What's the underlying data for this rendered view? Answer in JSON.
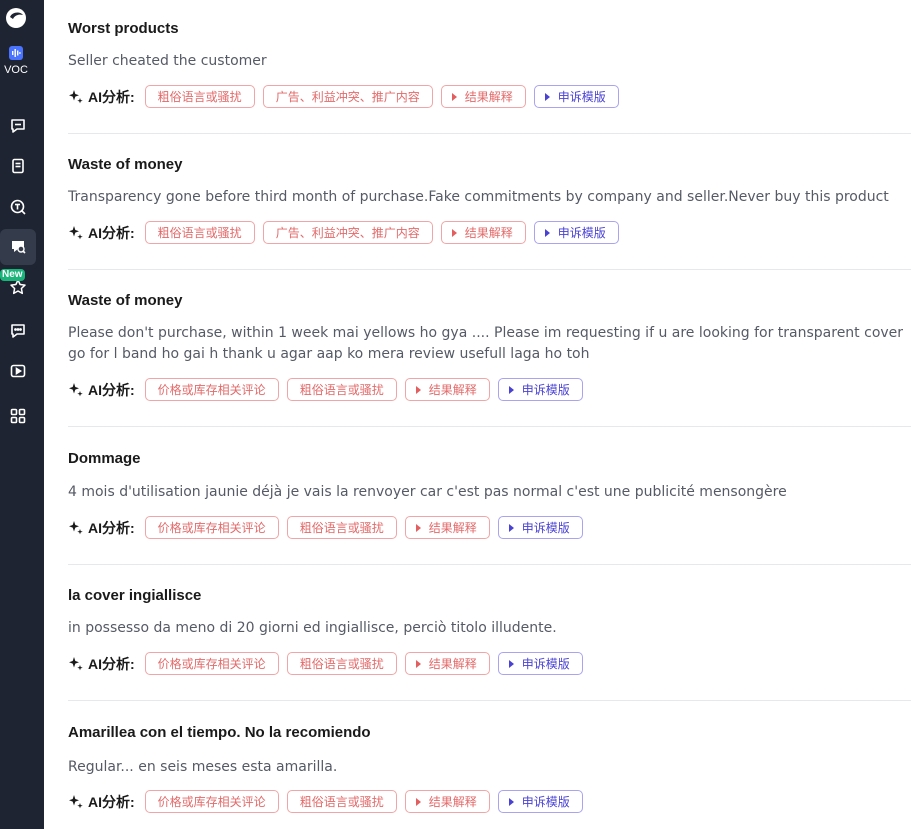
{
  "sidebar": {
    "voc_label": "VOC",
    "new_badge": "New",
    "items": [
      {
        "icon": "chat-bubble-icon"
      },
      {
        "icon": "document-icon"
      },
      {
        "icon": "search-t-icon"
      },
      {
        "icon": "review-search-icon",
        "active": true
      },
      {
        "icon": "star-icon"
      },
      {
        "icon": "message-dots-icon"
      },
      {
        "icon": "play-icon"
      },
      {
        "icon": "grid-apps-icon"
      }
    ]
  },
  "ai_label": "AI分析:",
  "reviews": [
    {
      "title": "Worst products",
      "body": "Seller cheated the customer",
      "tags": [
        "粗俗语言或骚扰",
        "广告、利益冲突、推广内容"
      ],
      "explain": "结果解释",
      "template": "申诉模版"
    },
    {
      "title": "Waste of money",
      "body": "Transparency gone before third month of purchase.Fake commitments by company and seller.Never buy this product",
      "tags": [
        "粗俗语言或骚扰",
        "广告、利益冲突、推广内容"
      ],
      "explain": "结果解释",
      "template": "申诉模版"
    },
    {
      "title": "Waste of money",
      "body": "Please don't purchase, within 1 week mai yellows ho gya .... Please im requesting if u are looking for transparent cover go for l band ho gai h thank u agar aap ko mera review usefull laga ho toh",
      "tags": [
        "价格或库存相关评论",
        "粗俗语言或骚扰"
      ],
      "explain": "结果解释",
      "template": "申诉模版"
    },
    {
      "title": "Dommage",
      "body": "4 mois d'utilisation jaunie déjà je vais la renvoyer car c'est pas normal c'est une publicité mensongère",
      "tags": [
        "价格或库存相关评论",
        "粗俗语言或骚扰"
      ],
      "explain": "结果解释",
      "template": "申诉模版"
    },
    {
      "title": "la cover ingiallisce",
      "body": "in possesso da meno di 20 giorni ed ingiallisce, perciò titolo illudente.",
      "tags": [
        "价格或库存相关评论",
        "粗俗语言或骚扰"
      ],
      "explain": "结果解释",
      "template": "申诉模版"
    },
    {
      "title": "Amarillea con el tiempo. No la recomiendo",
      "body": "Regular... en seis meses esta amarilla.",
      "tags": [
        "价格或库存相关评论",
        "粗俗语言或骚扰"
      ],
      "explain": "结果解释",
      "template": "申诉模版"
    }
  ]
}
